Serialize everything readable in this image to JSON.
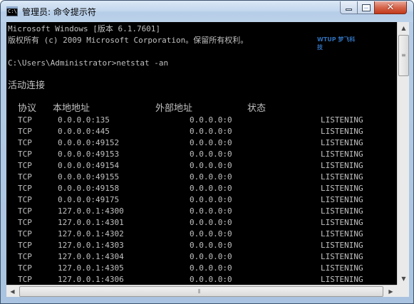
{
  "window": {
    "title": "管理员: 命令提示符",
    "icon_text": "C:\\",
    "minimize_icon": "minimize-icon",
    "maximize_icon": "maximize-icon",
    "close_icon": "close-icon",
    "close_glyph": "✕"
  },
  "console": {
    "banner_line1": "Microsoft Windows [版本 6.1.7601]",
    "banner_line2": "版权所有 (c) 2009 Microsoft Corporation。保留所有权利。",
    "prompt_line": "C:\\Users\\Administrator>netstat -an",
    "section_title": "活动连接",
    "headers": {
      "proto": "协议",
      "local": "本地地址",
      "foreign": "外部地址",
      "state": "状态"
    },
    "rows": [
      {
        "proto": "TCP",
        "local": "0.0.0.0:135",
        "foreign": "0.0.0.0:0",
        "state": "LISTENING"
      },
      {
        "proto": "TCP",
        "local": "0.0.0.0:445",
        "foreign": "0.0.0.0:0",
        "state": "LISTENING"
      },
      {
        "proto": "TCP",
        "local": "0.0.0.0:49152",
        "foreign": "0.0.0.0:0",
        "state": "LISTENING"
      },
      {
        "proto": "TCP",
        "local": "0.0.0.0:49153",
        "foreign": "0.0.0.0:0",
        "state": "LISTENING"
      },
      {
        "proto": "TCP",
        "local": "0.0.0.0:49154",
        "foreign": "0.0.0.0:0",
        "state": "LISTENING"
      },
      {
        "proto": "TCP",
        "local": "0.0.0.0:49155",
        "foreign": "0.0.0.0:0",
        "state": "LISTENING"
      },
      {
        "proto": "TCP",
        "local": "0.0.0.0:49158",
        "foreign": "0.0.0.0:0",
        "state": "LISTENING"
      },
      {
        "proto": "TCP",
        "local": "0.0.0.0:49175",
        "foreign": "0.0.0.0:0",
        "state": "LISTENING"
      },
      {
        "proto": "TCP",
        "local": "127.0.0.1:4300",
        "foreign": "0.0.0.0:0",
        "state": "LISTENING"
      },
      {
        "proto": "TCP",
        "local": "127.0.0.1:4301",
        "foreign": "0.0.0.0:0",
        "state": "LISTENING"
      },
      {
        "proto": "TCP",
        "local": "127.0.0.1:4302",
        "foreign": "0.0.0.0:0",
        "state": "LISTENING"
      },
      {
        "proto": "TCP",
        "local": "127.0.0.1:4303",
        "foreign": "0.0.0.0:0",
        "state": "LISTENING"
      },
      {
        "proto": "TCP",
        "local": "127.0.0.1:4304",
        "foreign": "0.0.0.0:0",
        "state": "LISTENING"
      },
      {
        "proto": "TCP",
        "local": "127.0.0.1:4305",
        "foreign": "0.0.0.0:0",
        "state": "LISTENING"
      },
      {
        "proto": "TCP",
        "local": "127.0.0.1:4306",
        "foreign": "0.0.0.0:0",
        "state": "LISTENING"
      }
    ],
    "watermark": "WTUP 梦飞科技"
  },
  "scrollbars": {
    "up_icon": "scroll-up-icon",
    "down_icon": "scroll-down-icon",
    "left_icon": "scroll-left-icon",
    "right_icon": "scroll-right-icon",
    "up_glyph": "▲",
    "down_glyph": "▼",
    "left_glyph": "◀",
    "right_glyph": "▶"
  },
  "colors": {
    "console_bg": "#000000",
    "console_text": "#c0c0c0",
    "close_button": "#c2391c"
  }
}
